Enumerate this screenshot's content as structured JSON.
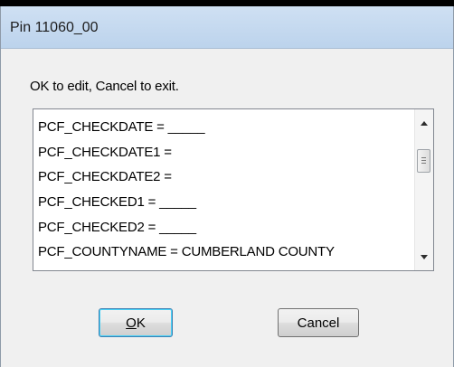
{
  "window": {
    "title": "Pin 11060_00"
  },
  "prompt": "OK to edit, Cancel to exit.",
  "list": {
    "items": [
      "PCF_CHECKDATE = _____",
      "PCF_CHECKDATE1 =",
      "PCF_CHECKDATE2 =",
      "PCF_CHECKED1 = _____",
      "PCF_CHECKED2 = _____",
      "PCF_COUNTYNAME = CUMBERLAND COUNTY"
    ]
  },
  "buttons": {
    "ok_mnemonic": "O",
    "ok_rest": "K",
    "cancel_label": "Cancel"
  },
  "icons": {
    "scroll_up": "arrow-up-icon",
    "scroll_down": "arrow-down-icon"
  }
}
